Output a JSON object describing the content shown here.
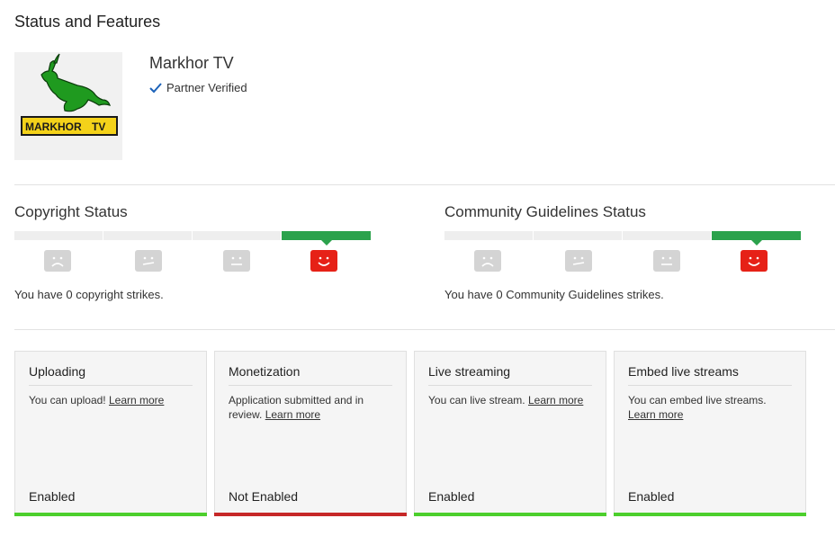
{
  "page": {
    "title": "Status and Features"
  },
  "channel": {
    "name": "Markhor TV",
    "verified_label": "Partner Verified",
    "logo_text": "MARKHOR TV"
  },
  "copyright": {
    "title": "Copyright Status",
    "summary": "You have 0 copyright strikes.",
    "strike_level": 0,
    "faces": [
      "sad-face-icon",
      "neutral-face-icon",
      "neutral-face-icon",
      "happy-face-icon"
    ]
  },
  "community": {
    "title": "Community Guidelines Status",
    "summary": "You have 0 Community Guidelines strikes.",
    "strike_level": 0,
    "faces": [
      "sad-face-icon",
      "neutral-face-icon",
      "neutral-face-icon",
      "happy-face-icon"
    ]
  },
  "features": [
    {
      "title": "Uploading",
      "desc": "You can upload!",
      "link": "Learn more",
      "state": "Enabled",
      "color": "#4ccf2c"
    },
    {
      "title": "Monetization",
      "desc": "Application submitted and in review.",
      "link": "Learn more",
      "state": "Not Enabled",
      "color": "#c62828"
    },
    {
      "title": "Live streaming",
      "desc": "You can live stream.",
      "link": "Learn more",
      "state": "Enabled",
      "color": "#4ccf2c"
    },
    {
      "title": "Embed live streams",
      "desc": "You can embed live streams.",
      "link": "Learn more",
      "state": "Enabled",
      "color": "#4ccf2c"
    }
  ],
  "colors": {
    "active_meter": "#2ba24c",
    "active_face": "#e62117",
    "inactive_face": "#d4d4d4"
  }
}
